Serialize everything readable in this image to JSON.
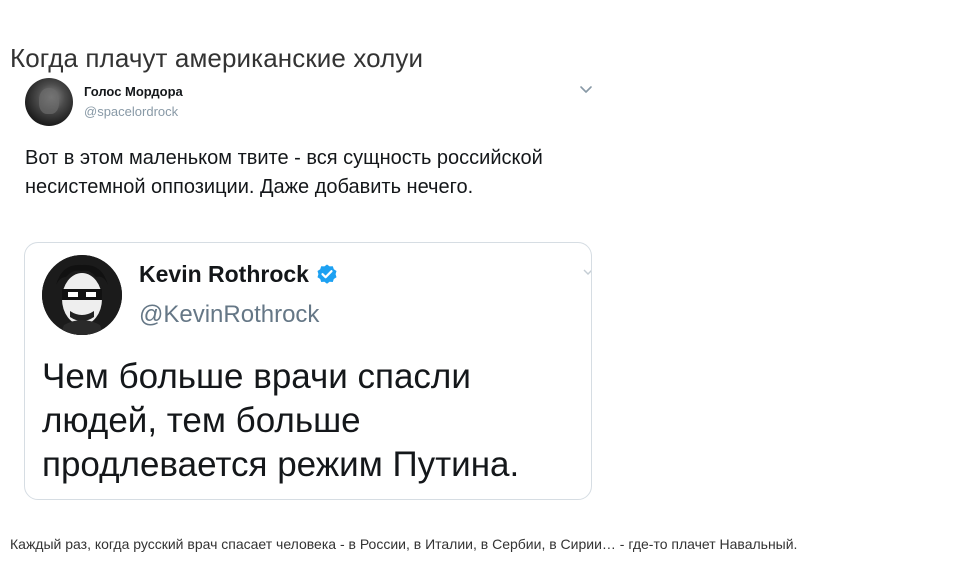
{
  "article": {
    "title": "Когда плачут американские холуи",
    "caption": "Каждый раз, когда русский врач спасает человека - в России, в Италии, в Сербии, в Сирии… - где-то плачет Навальный."
  },
  "tweet": {
    "author_name": "Голос Мордора",
    "author_handle": "@spacelordrock",
    "text": "Вот в этом маленьком твите - вся сущность российской несистемной оппозиции. Даже добавить нечего.",
    "menu_icon": "chevron-down-icon",
    "embedded": {
      "author_name": "Kevin Rothrock",
      "author_handle": "@KevinRothrock",
      "verified": true,
      "verified_icon": "verified-badge-icon",
      "text": "Чем больше врачи спасли людей, тем больше продлевается режим Путина."
    }
  },
  "colors": {
    "verified_blue": "#1da1f2",
    "handle_gray": "#8899a6",
    "card_border": "#d6dde3"
  }
}
